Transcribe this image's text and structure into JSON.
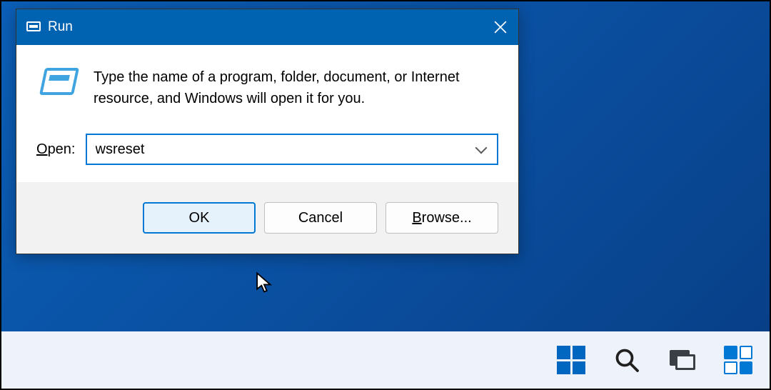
{
  "dialog": {
    "title": "Run",
    "description": "Type the name of a program, folder, document, or Internet resource, and Windows will open it for you.",
    "open_label_prefix": "O",
    "open_label_rest": "pen:",
    "input_value": "wsreset",
    "buttons": {
      "ok": "OK",
      "cancel": "Cancel",
      "browse_prefix": "B",
      "browse_rest": "rowse..."
    }
  },
  "taskbar": {
    "items": [
      "start",
      "search",
      "task-view",
      "widgets"
    ]
  }
}
